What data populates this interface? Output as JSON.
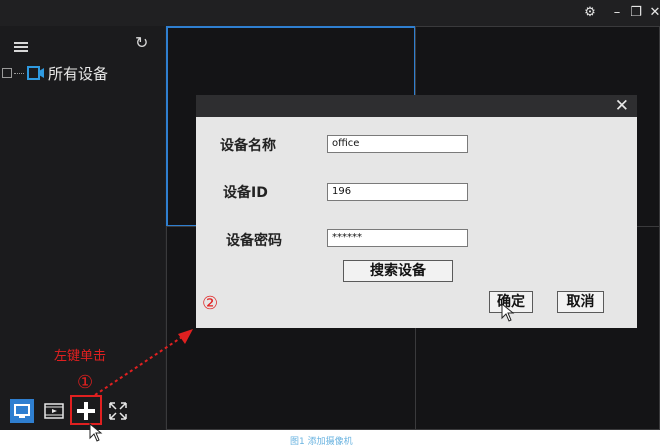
{
  "sidebar": {
    "tree_root_label": "所有设备"
  },
  "dialog": {
    "fields": [
      {
        "label": "设备名称",
        "value": "office"
      },
      {
        "label": "设备ID",
        "value": "196"
      },
      {
        "label": "设备密码",
        "value": "******"
      }
    ],
    "search_button": "搜索设备",
    "confirm_button": "确定",
    "cancel_button": "取消"
  },
  "annotations": {
    "step1": "①",
    "step2": "②",
    "left_click_text": "左键单击"
  },
  "caption": "图1 添加摄像机",
  "colors": {
    "accent_blue": "#2f7fd0",
    "annotation_red": "#e02020",
    "app_bg": "#1f1f21"
  }
}
